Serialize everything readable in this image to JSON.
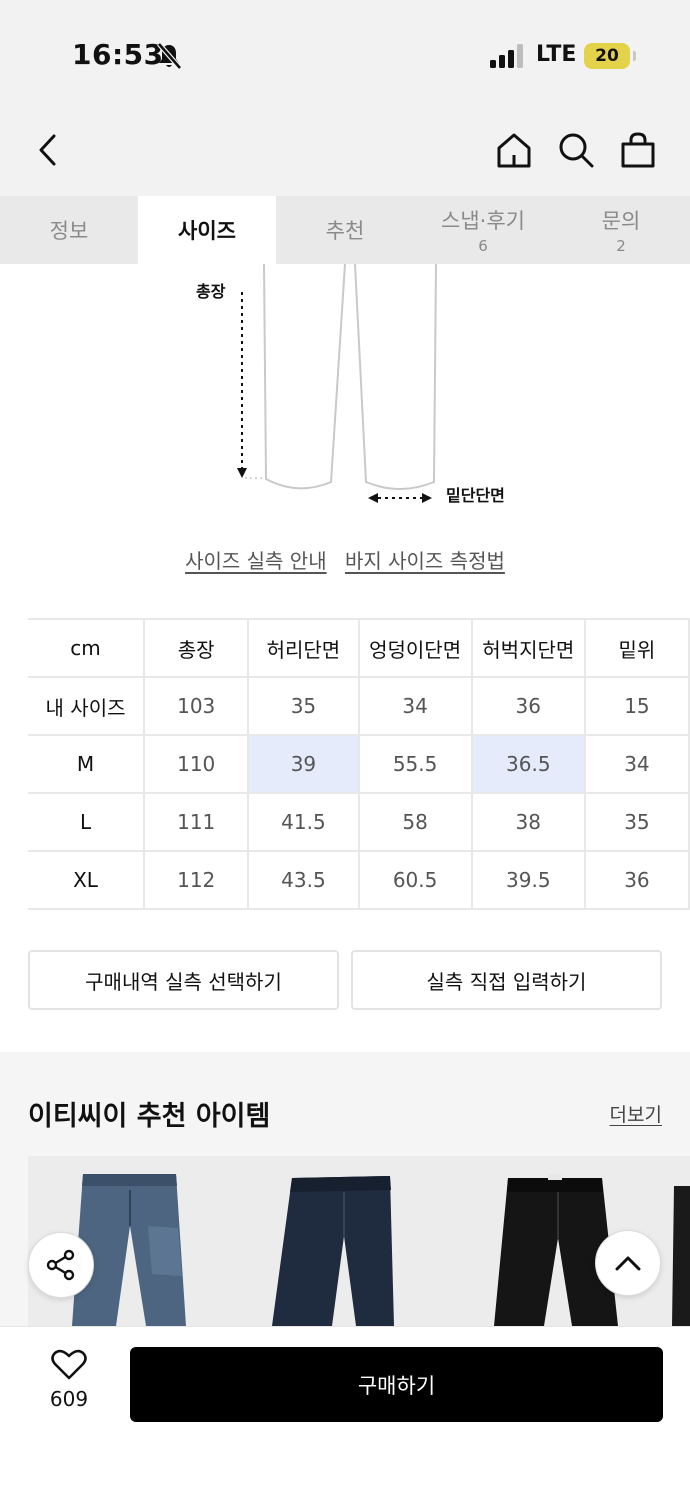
{
  "status_bar": {
    "time": "16:53",
    "network": "LTE",
    "battery": "20"
  },
  "tabs": [
    {
      "label": "정보",
      "count": ""
    },
    {
      "label": "사이즈",
      "count": ""
    },
    {
      "label": "추천",
      "count": ""
    },
    {
      "label": "스냅·후기",
      "count": "6"
    },
    {
      "label": "문의",
      "count": "2"
    }
  ],
  "active_tab": "사이즈",
  "diagram": {
    "length_label": "총장",
    "hem_label": "밑단단면"
  },
  "guide_links": {
    "size_guide": "사이즈 실측 안내",
    "measure_method": "바지 사이즈 측정법"
  },
  "size_table": {
    "headers": [
      "cm",
      "총장",
      "허리단면",
      "엉덩이단면",
      "허벅지단면",
      "밑위"
    ],
    "rows": [
      {
        "label": "내 사이즈",
        "values": [
          "103",
          "35",
          "34",
          "36",
          "15"
        ]
      },
      {
        "label": "M",
        "values": [
          "110",
          "39",
          "55.5",
          "36.5",
          "34"
        ]
      },
      {
        "label": "L",
        "values": [
          "111",
          "41.5",
          "58",
          "38",
          "35"
        ]
      },
      {
        "label": "XL",
        "values": [
          "112",
          "43.5",
          "60.5",
          "39.5",
          "36"
        ]
      }
    ]
  },
  "actions": {
    "select_purchase": "구매내역 실측 선택하기",
    "direct_input": "실측 직접 입력하기"
  },
  "recommend": {
    "title": "이티씨이 추천 아이템",
    "more": "더보기"
  },
  "bottom": {
    "like_count": "609",
    "buy_label": "구매하기"
  },
  "colors": {
    "highlight": "#e6ebfb",
    "buy_button": "#000000",
    "battery": "#e4d24a"
  },
  "icons": [
    "bell-off-icon",
    "signal-icon",
    "back-arrow-icon",
    "home-icon",
    "search-icon",
    "shopping-bag-icon",
    "share-icon",
    "chevron-up-icon",
    "heart-icon"
  ]
}
